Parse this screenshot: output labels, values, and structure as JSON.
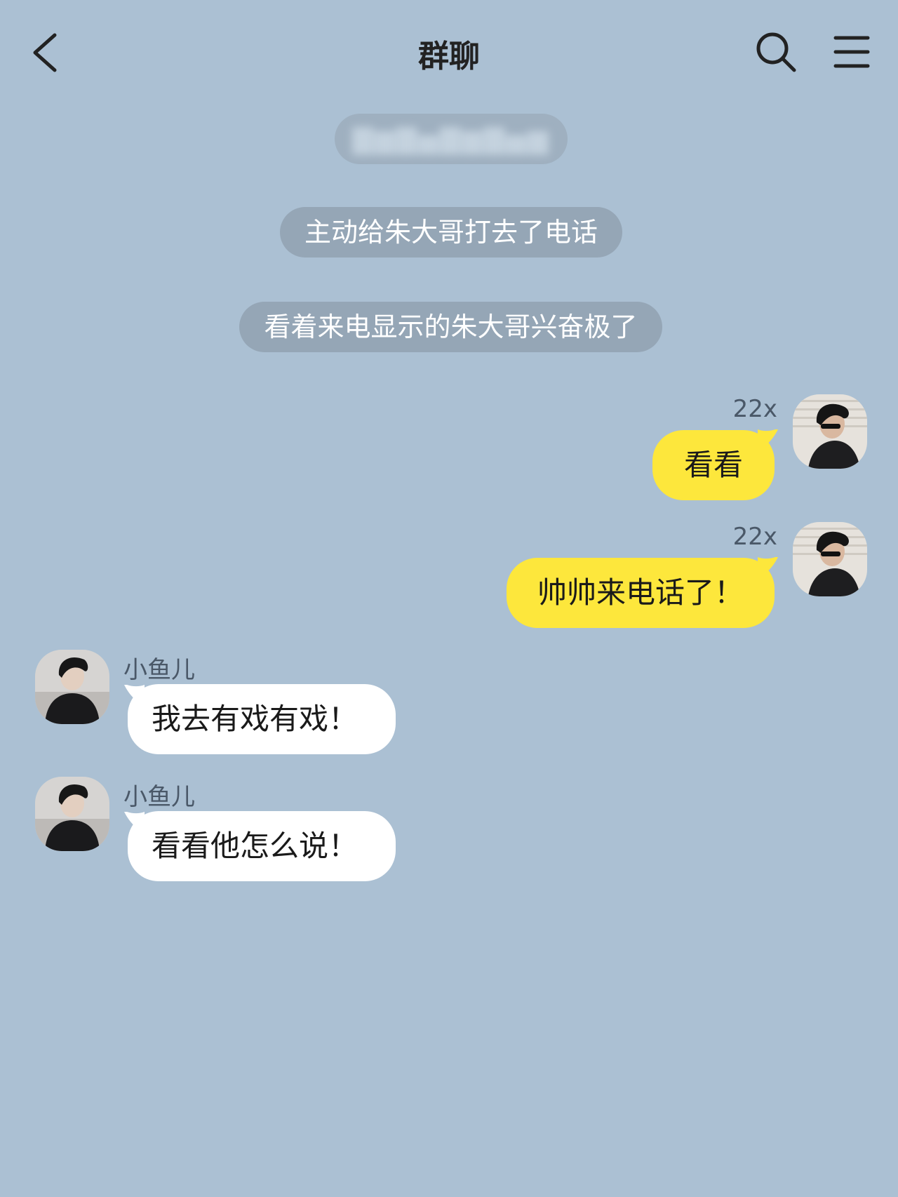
{
  "header": {
    "title": "群聊",
    "back_icon": "chevron-left-icon",
    "search_icon": "search-icon",
    "menu_icon": "hamburger-menu-icon"
  },
  "system_messages": [
    {
      "text": "主动给朱大哥打去了电话"
    },
    {
      "text": "看着来电显示的朱大哥兴奋极了"
    }
  ],
  "messages": [
    {
      "sender": "22x",
      "text": "看看",
      "side": "right"
    },
    {
      "sender": "22x",
      "text": "帅帅来电话了！",
      "side": "right"
    },
    {
      "sender": "小鱼儿",
      "text": "我去有戏有戏！",
      "side": "left"
    },
    {
      "sender": "小鱼儿",
      "text": "看看他怎么说！",
      "side": "left"
    }
  ],
  "colors": {
    "background": "#abc0d3",
    "my_bubble": "#fde73c",
    "other_bubble": "#ffffff",
    "system_pill": "#95a6b6"
  }
}
